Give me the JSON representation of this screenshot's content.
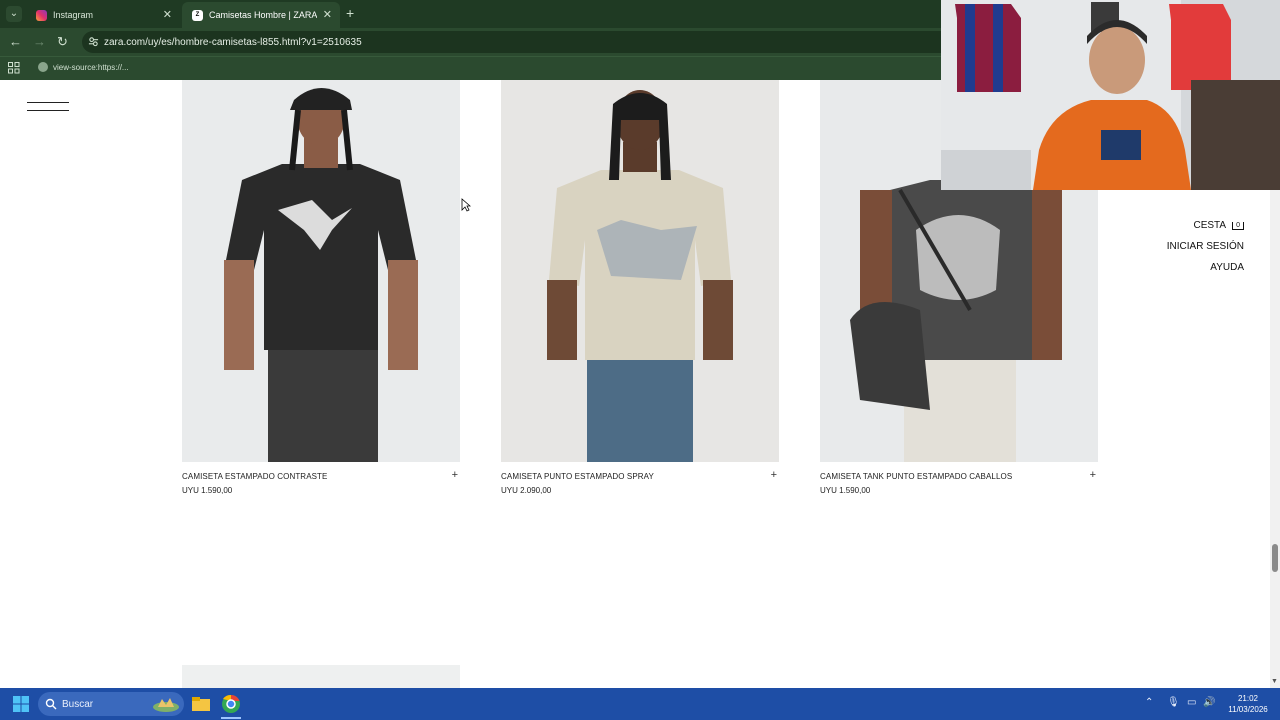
{
  "browser": {
    "tabs": [
      {
        "label": "Instagram",
        "icon": "instagram-icon"
      },
      {
        "label": "Camisetas Hombre | ZARA Urugu",
        "icon": "zara-favicon",
        "active": true
      }
    ],
    "url": "zara.com/uy/es/hombre-camisetas-l855.html?v1=2510635",
    "bookmark": "view-source:https://..."
  },
  "products": [
    {
      "name": "CAMISETA ESTAMPADO CONTRASTE",
      "price": "UYU 1.590,00"
    },
    {
      "name": "CAMISETA PUNTO ESTAMPADO SPRAY",
      "price": "UYU 2.090,00"
    },
    {
      "name": "CAMISETA TANK PUNTO ESTAMPADO CABALLOS",
      "price": "UYU 1.590,00"
    }
  ],
  "sidenav": {
    "cart_label": "CESTA",
    "cart_count": "0",
    "login_label": "INICIAR SESIÓN",
    "help_label": "AYUDA"
  },
  "add_symbol": "+",
  "taskbar": {
    "search_placeholder": "Buscar",
    "time": "21:02",
    "date": "11/03/2026"
  },
  "colors": {
    "browser_dark": "#1f3a23",
    "browser_mid": "#2b4a2f",
    "taskbar": "#1e4ea6"
  }
}
